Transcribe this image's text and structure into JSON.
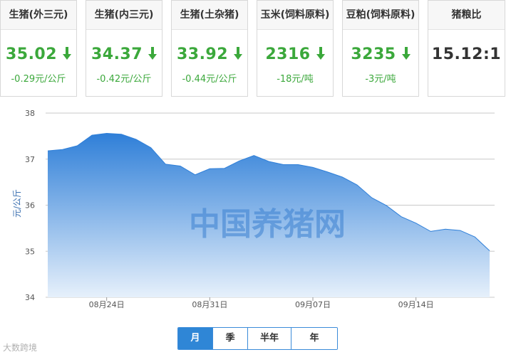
{
  "cards": [
    {
      "title": "生猪(外三元)",
      "value": "35.02",
      "change": "-0.29元/公斤",
      "trend": "down"
    },
    {
      "title": "生猪(内三元)",
      "value": "34.37",
      "change": "-0.42元/公斤",
      "trend": "down"
    },
    {
      "title": "生猪(土杂猪)",
      "value": "33.92",
      "change": "-0.44元/公斤",
      "trend": "down"
    },
    {
      "title": "玉米(饲料原料)",
      "value": "2316",
      "change": "-18元/吨",
      "trend": "down"
    },
    {
      "title": "豆粕(饲料原料)",
      "value": "3235",
      "change": "-3元/吨",
      "trend": "down"
    },
    {
      "title": "猪粮比",
      "value": "15.12:1",
      "change": "",
      "trend": "none"
    }
  ],
  "chart_data": {
    "type": "area",
    "ylabel": "元/公斤",
    "ylim": [
      34,
      38
    ],
    "yticks": [
      34,
      35,
      36,
      37,
      38
    ],
    "xtick_labels": [
      "08月24日",
      "08月31日",
      "09月07日",
      "09月14日"
    ],
    "watermark": "中国养猪网",
    "x": [
      "08月20日",
      "08月21日",
      "08月22日",
      "08月23日",
      "08月24日",
      "08月25日",
      "08月26日",
      "08月27日",
      "08月28日",
      "08月29日",
      "08月30日",
      "08月31日",
      "09月01日",
      "09月02日",
      "09月03日",
      "09月04日",
      "09月05日",
      "09月06日",
      "09月07日",
      "09月08日",
      "09月09日",
      "09月10日",
      "09月11日",
      "09月12日",
      "09月13日",
      "09月14日",
      "09月15日",
      "09月16日",
      "09月17日",
      "09月18日",
      "09月19日"
    ],
    "values": [
      37.18,
      37.21,
      37.29,
      37.52,
      37.56,
      37.54,
      37.43,
      37.25,
      36.89,
      36.85,
      36.66,
      36.79,
      36.8,
      36.96,
      37.08,
      36.95,
      36.88,
      36.88,
      36.82,
      36.72,
      36.61,
      36.44,
      36.16,
      35.99,
      35.75,
      35.61,
      35.43,
      35.48,
      35.45,
      35.31,
      35.01
    ],
    "colors": {
      "top": "#2f7fd8",
      "bottom": "#e6f0fb",
      "line": "#2f7fd8",
      "grid": "#c8c8c8"
    }
  },
  "tabs": [
    "月",
    "季",
    "半年",
    "年"
  ],
  "active_tab": "月",
  "logo_text": "大数跨境"
}
